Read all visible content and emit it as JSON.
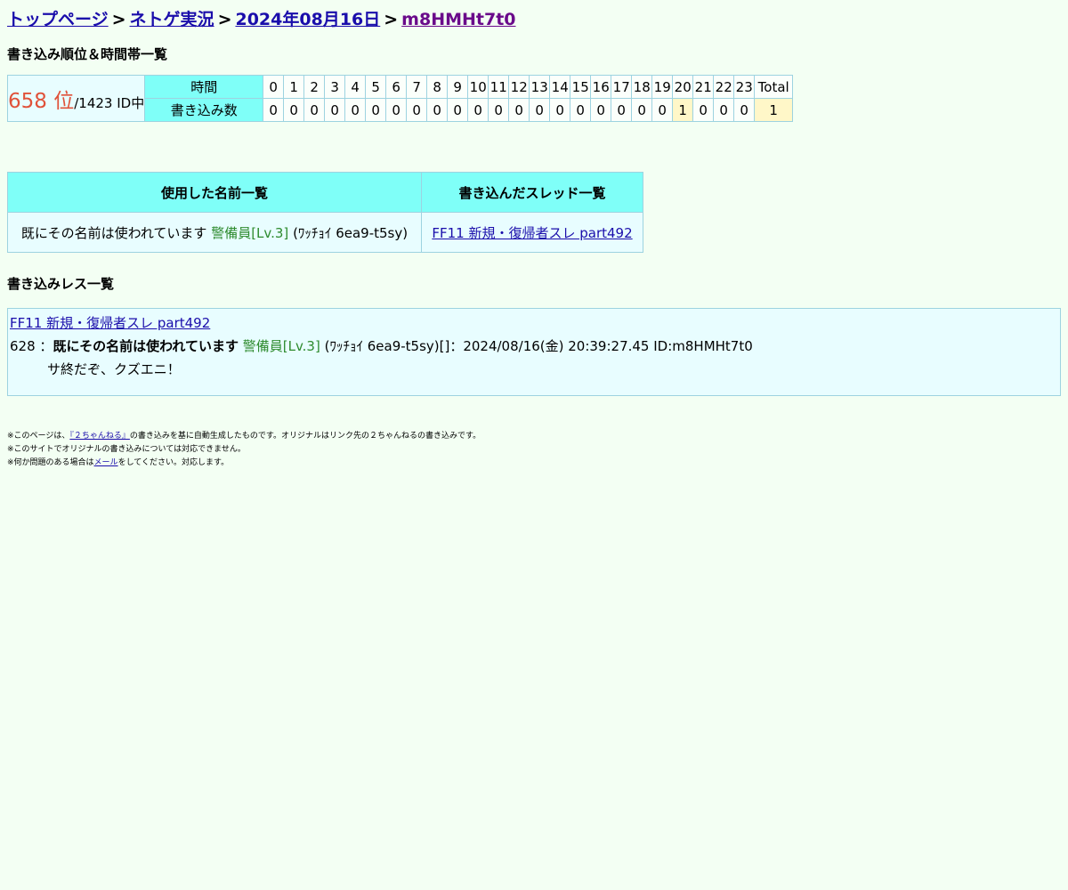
{
  "breadcrumb": {
    "top": "トップページ",
    "board": "ネトゲ実況",
    "date": "2024年08月16日",
    "id": "m8HMHt7t0",
    "sep": ">"
  },
  "section1_title": "書き込み順位＆時間帯一覧",
  "rank": {
    "position": "658 位",
    "total_ids": "/1423 ID中",
    "time_label": "時間",
    "count_label": "書き込み数",
    "hours": [
      "0",
      "1",
      "2",
      "3",
      "4",
      "5",
      "6",
      "7",
      "8",
      "9",
      "10",
      "11",
      "12",
      "13",
      "14",
      "15",
      "16",
      "17",
      "18",
      "19",
      "20",
      "21",
      "22",
      "23"
    ],
    "total_label": "Total",
    "counts": [
      "0",
      "0",
      "0",
      "0",
      "0",
      "0",
      "0",
      "0",
      "0",
      "0",
      "0",
      "0",
      "0",
      "0",
      "0",
      "0",
      "0",
      "0",
      "0",
      "0",
      "1",
      "0",
      "0",
      "0"
    ],
    "total": "1"
  },
  "names_table": {
    "col1_header": "使用した名前一覧",
    "col2_header": "書き込んだスレッド一覧",
    "name_plain": "既にその名前は使われています",
    "name_rank": "警備員[Lv.3]",
    "name_trip": "(ﾜｯﾁｮｲ 6ea9-t5sy)",
    "thread_link": "FF11 新規・復帰者スレ part492"
  },
  "section2_title": "書き込みレス一覧",
  "res": {
    "thread_title": "FF11 新規・復帰者スレ part492",
    "number": "628",
    "colon": "：",
    "name_bold": "既にその名前は使われています",
    "name_rank": "警備員[Lv.3]",
    "meta": "(ﾜｯﾁｮｲ 6ea9-t5sy)[]：2024/08/16(金) 20:39:27.45 ID:m8HMHt7t0",
    "body": "サ終だぞ、クズエニ！"
  },
  "footer": {
    "line1_prefix": "※このページは、",
    "line1_link": "『２ちゃんねる』",
    "line1_suffix": "の書き込みを基に自動生成したものです。オリジナルはリンク先の２ちゃんねるの書き込みです。",
    "line2": "※このサイトでオリジナルの書き込みについては対応できません。",
    "line3_prefix": "※何か問題のある場合は",
    "line3_link": "メール",
    "line3_suffix": "をしてください。対応します。"
  }
}
